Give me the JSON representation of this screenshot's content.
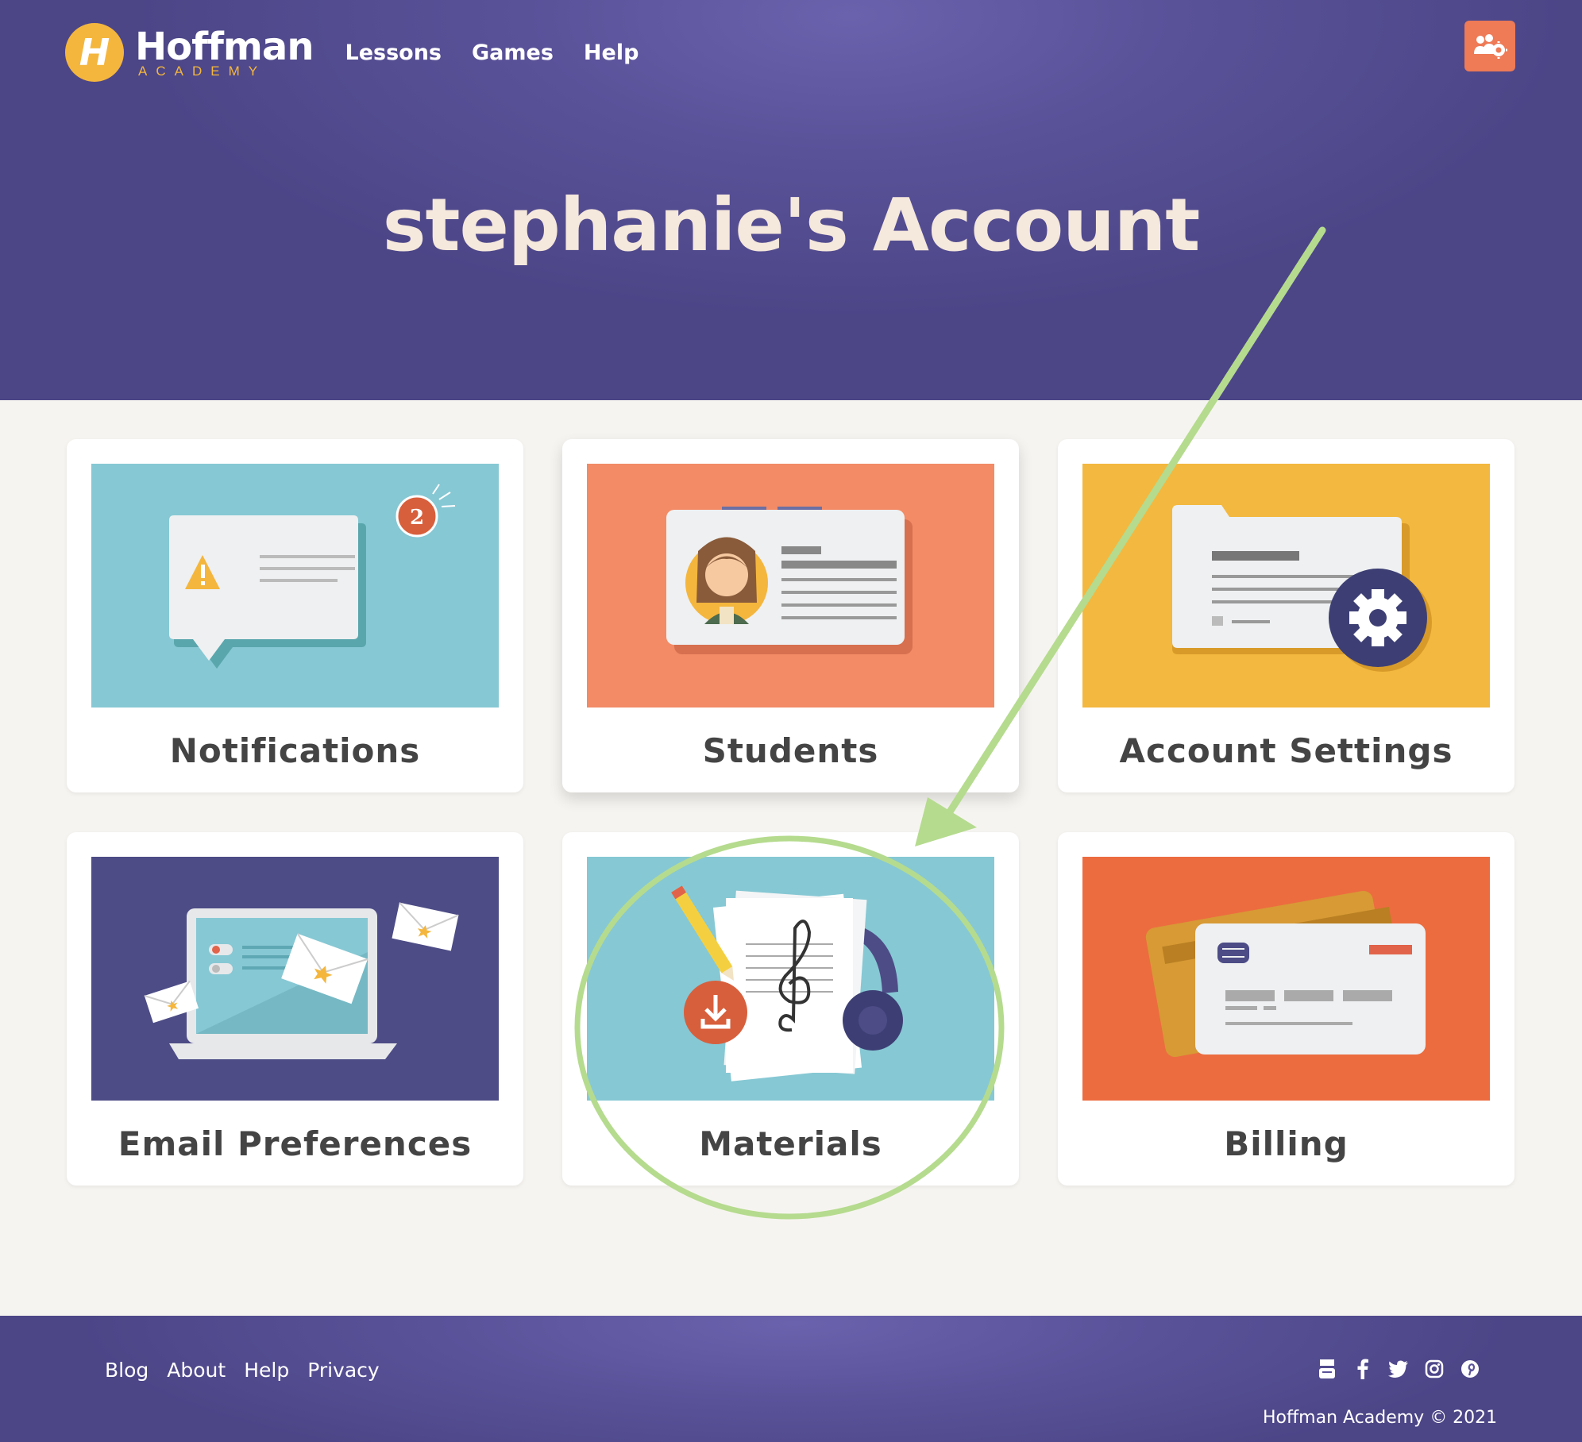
{
  "nav": {
    "logo_letter": "H",
    "logo_name": "Hoffman",
    "logo_sub": "ACADEMY",
    "links": [
      "Lessons",
      "Games",
      "Help"
    ]
  },
  "hero": {
    "title": "stephanie's Account"
  },
  "cards": [
    {
      "label": "Notifications",
      "badge": "2"
    },
    {
      "label": "Students"
    },
    {
      "label": "Account Settings"
    },
    {
      "label": "Email Preferences"
    },
    {
      "label": "Materials"
    },
    {
      "label": "Billing"
    }
  ],
  "footer": {
    "links": [
      "Blog",
      "About",
      "Help",
      "Privacy"
    ],
    "social_icons": [
      "youtube-icon",
      "facebook-icon",
      "twitter-icon",
      "instagram-icon",
      "pinterest-icon"
    ],
    "copyright": "Hoffman Academy © 2021"
  },
  "colors": {
    "hero_purple": "#5a5299",
    "accent_orange": "#ee7a56",
    "logo_yellow": "#f4b63d",
    "annotation_green": "#b5db8e",
    "teal": "#86c8d4",
    "salmon": "#f28b66",
    "gold": "#f3b83f",
    "indigo": "#4d4c86",
    "orange_red": "#ec6c3f"
  }
}
